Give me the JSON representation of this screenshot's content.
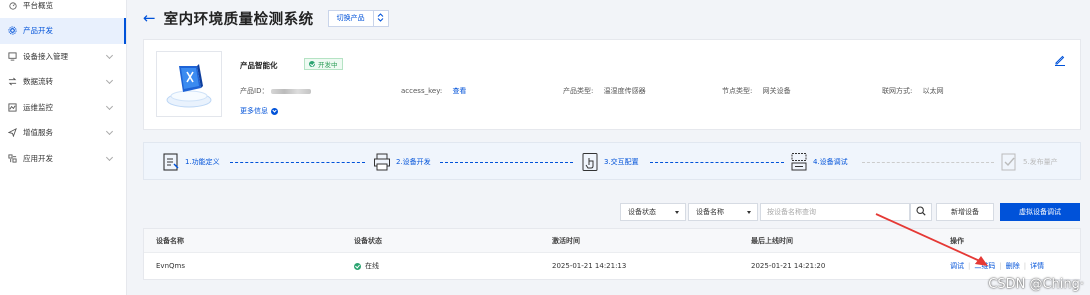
{
  "sidebar": {
    "items": [
      {
        "label": "平台概览",
        "icon": "dashboard-icon",
        "active": false,
        "expandable": false
      },
      {
        "label": "产品开发",
        "icon": "gear-icon",
        "active": true,
        "expandable": false
      },
      {
        "label": "设备接入管理",
        "icon": "device-icon",
        "active": false,
        "expandable": true
      },
      {
        "label": "数据流转",
        "icon": "flow-icon",
        "active": false,
        "expandable": true
      },
      {
        "label": "运维监控",
        "icon": "monitor-icon",
        "active": false,
        "expandable": true
      },
      {
        "label": "增值服务",
        "icon": "service-icon",
        "active": false,
        "expandable": true
      },
      {
        "label": "应用开发",
        "icon": "app-icon",
        "active": false,
        "expandable": true
      }
    ]
  },
  "header": {
    "back_arrow": "←",
    "title": "室内环境质量检测系统",
    "switch_label": "切换产品"
  },
  "product": {
    "name": "产品智能化",
    "status": "开发中",
    "id_label": "产品ID：",
    "access_key_label": "access_key:",
    "access_key_link": "查看",
    "type_label": "产品类型:",
    "type_value": "温湿度传感器",
    "node_label": "节点类型:",
    "node_value": "网关设备",
    "net_label": "联网方式:",
    "net_value": "以太网",
    "more_info": "更多信息"
  },
  "steps": [
    {
      "label": "1.功能定义",
      "icon": "definition-icon",
      "enabled": true
    },
    {
      "label": "2.设备开发",
      "icon": "printer-icon",
      "enabled": true
    },
    {
      "label": "3.交互配置",
      "icon": "touch-icon",
      "enabled": true
    },
    {
      "label": "4.设备调试",
      "icon": "debug-icon",
      "enabled": true
    },
    {
      "label": "5.发布量产",
      "icon": "publish-icon",
      "enabled": false
    }
  ],
  "toolbar": {
    "status_select": "设备状态",
    "name_select": "设备名称",
    "search_placeholder": "按设备名称查询",
    "add_device": "新增设备",
    "virtual_debug": "虚拟设备调试"
  },
  "table": {
    "headers": [
      "设备名称",
      "设备状态",
      "激活时间",
      "最后上线时间",
      "操作"
    ],
    "rows": [
      {
        "name": "EvnQms",
        "status": "在线",
        "activated": "2025-01-21 14:21:13",
        "last_online": "2025-01-21 14:21:20",
        "actions": [
          "调试",
          "二维码",
          "删除",
          "详情"
        ]
      }
    ]
  },
  "watermark": "CSDN @Ching·",
  "colors": {
    "accent": "#0052d9",
    "success": "#2ba471",
    "annotation": "#e53935"
  }
}
